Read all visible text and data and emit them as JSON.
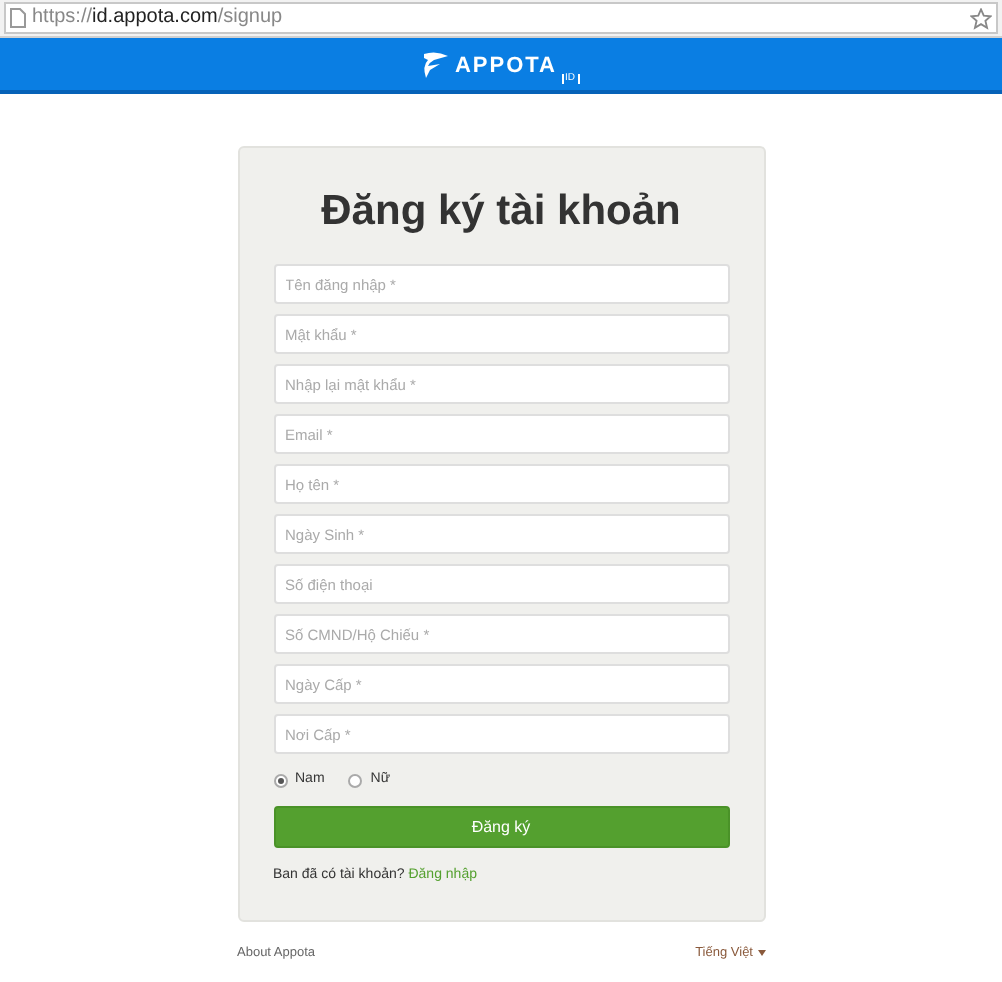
{
  "browser": {
    "url_prefix": "https://",
    "url_host": "id.appota.com",
    "url_path": "/signup"
  },
  "header": {
    "logo_name": "APPOTA",
    "logo_tag": "ID"
  },
  "form": {
    "title": "Đăng ký tài khoản",
    "fields": [
      {
        "placeholder": "Tên đăng nhập *"
      },
      {
        "placeholder": "Mật khẩu *"
      },
      {
        "placeholder": "Nhập lại mật khẩu *"
      },
      {
        "placeholder": "Email *"
      },
      {
        "placeholder": "Họ tên *"
      },
      {
        "placeholder": "Ngày Sinh *"
      },
      {
        "placeholder": "Số điện thoại"
      },
      {
        "placeholder": "Số CMND/Hộ Chiếu *"
      },
      {
        "placeholder": "Ngày Cấp *"
      },
      {
        "placeholder": "Nơi Cấp *"
      }
    ],
    "gender": [
      {
        "label": "Nam",
        "selected": true
      },
      {
        "label": "Nữ",
        "selected": false
      }
    ],
    "submit": "Đăng ký",
    "login_prompt": "Ban đã có tài khoản?",
    "login_link": "Đăng nhập"
  },
  "footer": {
    "about": "About Appota",
    "language": "Tiếng Việt"
  }
}
